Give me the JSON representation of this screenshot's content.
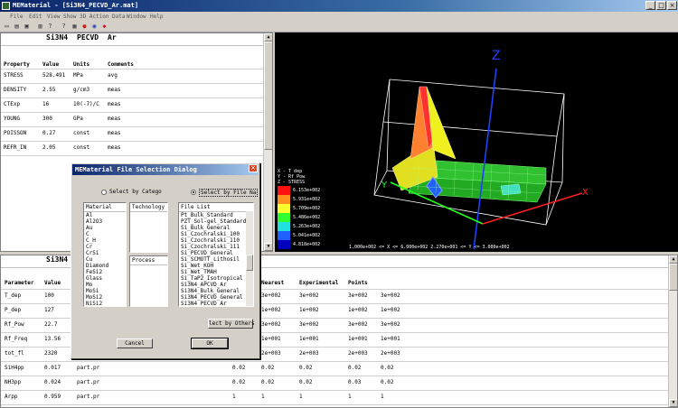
{
  "window": {
    "title": "MEMaterial - [Si3N4_PECVD_Ar.mat]",
    "icon": "app-icon"
  },
  "menu": [
    "File",
    "Edit",
    "View",
    "Show",
    "3D Action",
    "Data",
    "Window",
    "Help"
  ],
  "toolbar": [
    "new-icon",
    "open-icon",
    "save-icon",
    "print-icon",
    "help-icon",
    "query-icon",
    "chart-icon",
    "globe-icon",
    "flag-icon",
    "export-icon"
  ],
  "top_table": {
    "header": {
      "material": "Si3N4",
      "process": "PECVD",
      "gas": "Ar"
    },
    "columns": [
      "Property",
      "Value",
      "Units",
      "Comments"
    ],
    "rows": [
      [
        "STRESS",
        "528.491",
        "MPa",
        "avg"
      ],
      [
        "DENSITY",
        "2.55",
        "g/cm3",
        "meas"
      ],
      [
        "CTExp",
        "16",
        "10(-7)/C",
        "meas"
      ],
      [
        "YOUNG",
        "300",
        "GPa",
        "meas"
      ],
      [
        "POISSON",
        "0.27",
        "const",
        "meas"
      ],
      [
        "REFR_IN",
        "2.05",
        "const",
        "meas"
      ]
    ]
  },
  "view3d": {
    "legend_axes": [
      "X - T dep",
      "Y - Rf Pow",
      "Z - STRESS"
    ],
    "legend_values": [
      "6.153e+002",
      "5.931e+002",
      "5.709e+002",
      "5.486e+002",
      "5.263e+002",
      "5.041e+002",
      "4.818e+002"
    ],
    "legend_colors": [
      "#ff1010",
      "#ff9020",
      "#ffff30",
      "#30ff30",
      "#20e0e0",
      "#2060ff",
      "#0000c0"
    ],
    "footer": "1.000e+002 <= X <= 6.000e+002  2.270e+001 <= Y <= 3.000e+002",
    "axis_labels": {
      "x": "X",
      "y": "Y",
      "z": "Z"
    }
  },
  "bottom_table": {
    "header": {
      "material": "Si3N4"
    },
    "columns": [
      "Parameter",
      "Value",
      "",
      "",
      "",
      "",
      "Nearest",
      "Experimental",
      "Points",
      ""
    ],
    "rows": [
      [
        "T_dep",
        "100",
        "",
        "",
        "",
        "",
        "3e+002",
        "3e+002",
        "3e+002",
        "3e+002"
      ],
      [
        "P_dep",
        "127",
        "",
        "",
        "",
        "",
        "1e+002",
        "1e+002",
        "1e+002",
        "1e+002"
      ],
      [
        "Rf_Pow",
        "22.7",
        "",
        "",
        "",
        "",
        "3e+002",
        "3e+002",
        "3e+002",
        "3e+002"
      ],
      [
        "Rf_Freq",
        "13.56",
        "",
        "",
        "",
        "",
        "1e+001",
        "1e+001",
        "1e+001",
        "1e+001"
      ],
      [
        "tot_fl",
        "2320",
        "",
        "",
        "",
        "",
        "2e+003",
        "2e+003",
        "2e+003",
        "2e+003"
      ],
      [
        "SiH4pp",
        "0.017",
        "part.pr",
        "",
        "0.02",
        "",
        "0.02",
        "0.02",
        "0.02",
        "0.02"
      ],
      [
        "NH3pp",
        "0.024",
        "part.pr",
        "",
        "0.02",
        "",
        "0.02",
        "0.02",
        "0.03",
        "0.02"
      ],
      [
        "Arpp",
        "0.959",
        "part.pr",
        "",
        "1",
        "",
        "1",
        "1",
        "1",
        "1"
      ]
    ]
  },
  "dialog": {
    "title": "MEMaterial File Selection Dialog",
    "radio_category": "Select by Catego",
    "radio_filename": "Select by File Na",
    "material_header": "Material",
    "technology_header": "Technology",
    "process_header": "Process",
    "filelist_header": "File List",
    "materials": [
      "Al",
      "Al2O3",
      "Au",
      "C",
      "C_H",
      "Cr",
      "CrSi",
      "Cu",
      "Diamond",
      "FeSi2",
      "Glass",
      "Mo",
      "MoSi",
      "MoSi2",
      "NiSi2"
    ],
    "files": [
      "Pt_Bulk_Standard",
      "PZT_Sol-gel_Standard",
      "Si_Bulk_General",
      "Si_Czochralski_100",
      "Si_Czochralski_110",
      "Si_Czochralski_111",
      "Si_PECVD_General",
      "Si_SCMOTT_Lithosil",
      "Si_Wet_KOH",
      "Si_Wet_TMAH",
      "Si_TaP2_Isotropical",
      "Si3N4_APCVD_Ar",
      "Si3N4_Bulk_General",
      "Si3N4_PECVD_General",
      "Si3N4_PECVD_Ar"
    ],
    "other_button": "lect by Others",
    "cancel_button": "Cancel",
    "ok_button": "OK"
  }
}
